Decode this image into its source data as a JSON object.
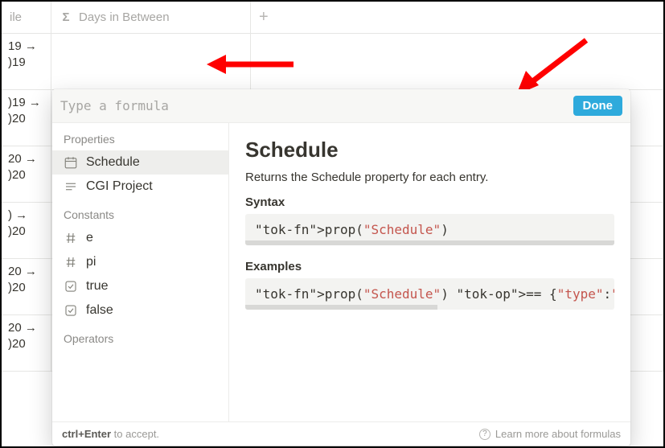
{
  "table": {
    "header_fragment": "ile",
    "formula_col_label": "Days in Between",
    "rows": [
      {
        "line1": "19 →",
        "line2": ")19"
      },
      {
        "line1": ")19 →",
        "line2": ")20"
      },
      {
        "line1": "20 →",
        "line2": ")20"
      },
      {
        "line1": ") →",
        "line2": ")20"
      },
      {
        "line1": "20 →",
        "line2": ")20"
      },
      {
        "line1": "20 →",
        "line2": ")20"
      }
    ]
  },
  "popup": {
    "input_placeholder": "Type a formula",
    "done_label": "Done",
    "sidebar": {
      "groups": [
        {
          "label": "Properties",
          "items": [
            {
              "icon": "date",
              "label": "Schedule",
              "selected": true
            },
            {
              "icon": "text",
              "label": "CGI Project",
              "selected": false
            }
          ]
        },
        {
          "label": "Constants",
          "items": [
            {
              "icon": "hash",
              "label": "e",
              "selected": false
            },
            {
              "icon": "hash",
              "label": "pi",
              "selected": false
            },
            {
              "icon": "checkbox",
              "label": "true",
              "selected": false
            },
            {
              "icon": "checkbox",
              "label": "false",
              "selected": false
            }
          ]
        },
        {
          "label": "Operators",
          "items": []
        }
      ]
    },
    "content": {
      "title": "Schedule",
      "description": "Returns the Schedule property for each entry.",
      "syntax_label": "Syntax",
      "syntax_code": "prop(\"Schedule\")",
      "examples_label": "Examples",
      "examples_code": "prop(\"Schedule\") == {\"type\":\"daterange\",\"start_"
    },
    "footer": {
      "shortcut_key": "ctrl+Enter",
      "shortcut_rest": " to accept.",
      "learn_more": "Learn more about formulas"
    }
  }
}
